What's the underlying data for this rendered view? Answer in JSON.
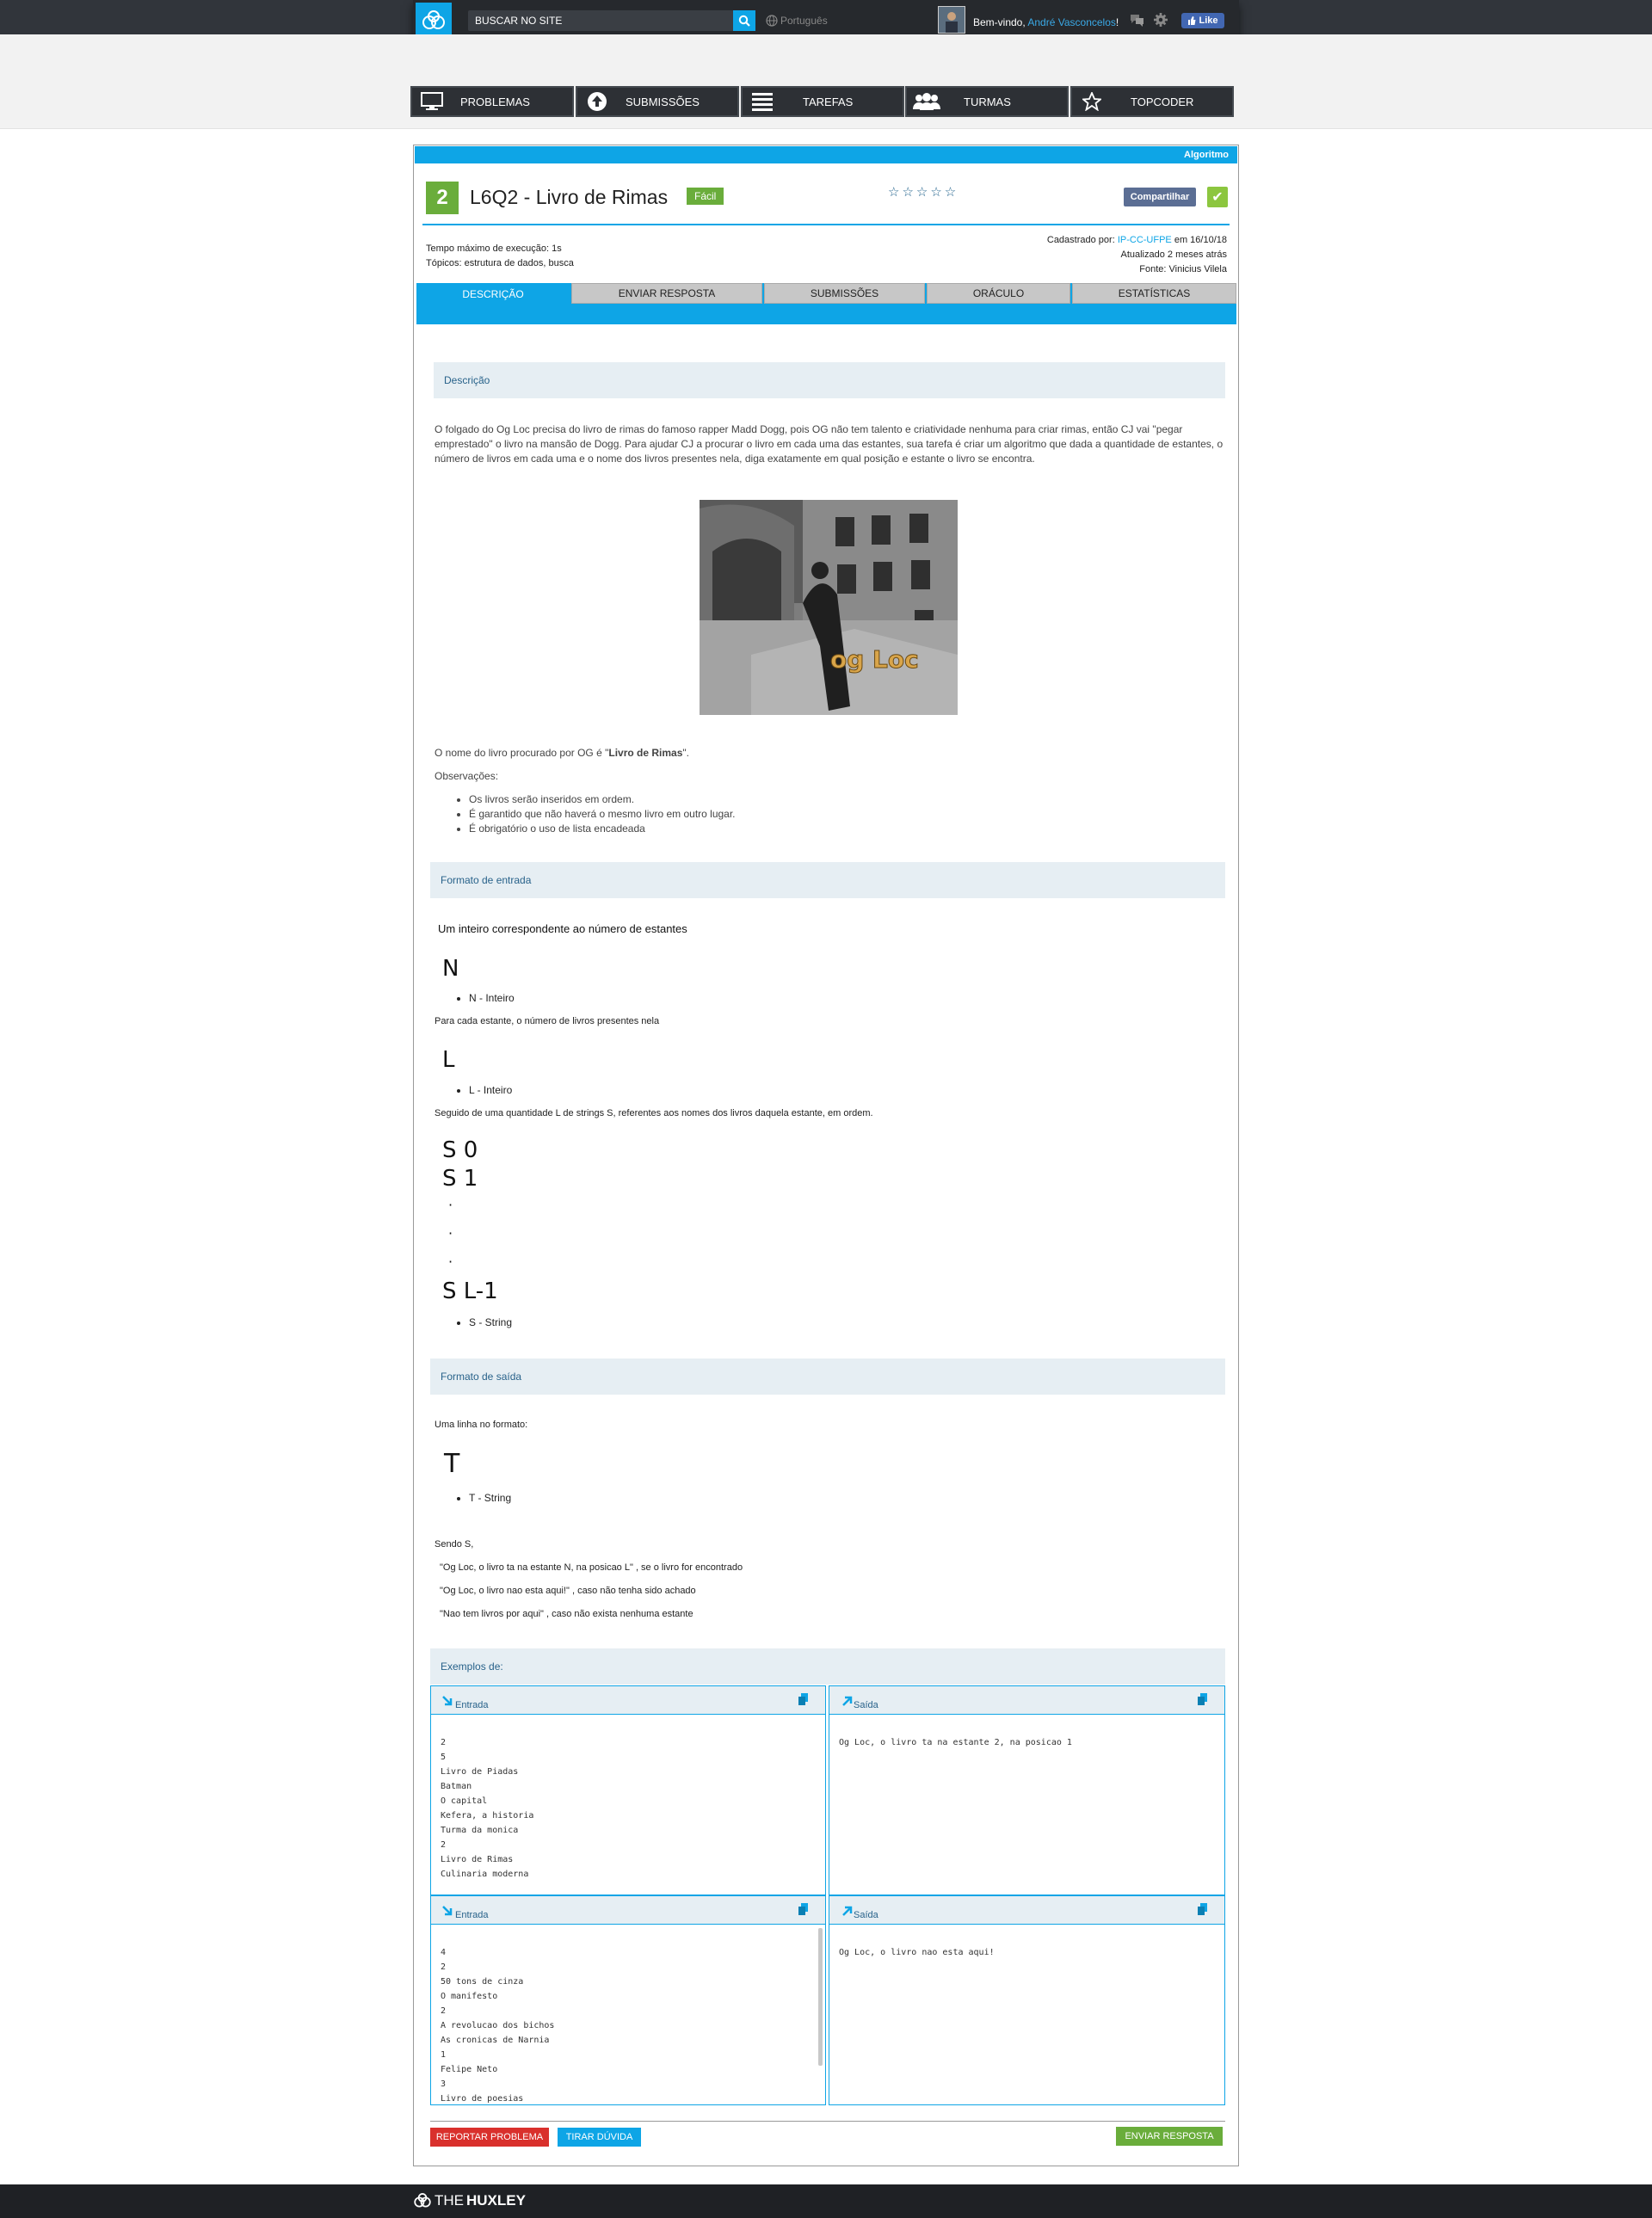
{
  "header": {
    "search_placeholder": "BUSCAR NO SITE",
    "language": "Português",
    "welcome_prefix": "Bem-vindo,",
    "user_name": "André Vasconcelos",
    "welcome_suffix": "!",
    "like_label": "Like"
  },
  "nav": [
    {
      "label": "PROBLEMAS",
      "icon": "monitor-icon"
    },
    {
      "label": "SUBMISSÕES",
      "icon": "upload-icon"
    },
    {
      "label": "TAREFAS",
      "icon": "list-icon"
    },
    {
      "label": "TURMAS",
      "icon": "group-icon"
    },
    {
      "label": "TOPCODER",
      "icon": "star-icon"
    }
  ],
  "problem": {
    "category": "Algoritmo",
    "number": "2",
    "title": "L6Q2 - Livro de Rimas",
    "difficulty": "Fácil",
    "rating_stars": "☆☆☆☆☆",
    "share_label": "Compartilhar",
    "time_limit": "Tempo máximo de execução: 1s",
    "topics": "Tópicos: estrutura de dados, busca",
    "registered_prefix": "Cadastrado por:",
    "registered_by": "IP-CC-UFPE",
    "registered_date": "em 16/10/18",
    "updated": "Atualizado 2 meses atrás",
    "source": "Fonte: Vinicius Vilela"
  },
  "tabs": [
    "DESCRIÇÃO",
    "ENVIAR RESPOSTA",
    "SUBMISSÕES",
    "ORÁCULO",
    "ESTATÍSTICAS"
  ],
  "description": {
    "heading": "Descrição",
    "para1": "O folgado do  Og Loc precisa do livro de rimas do famoso rapper Madd Dogg, pois OG não tem talento e criatividade nenhuma para criar rimas, então CJ vai \"pegar emprestado\" o livro na mansão de Dogg. Para ajudar CJ a procurar o livro em cada uma das estantes, sua tarefa é criar um algoritmo que dada a quantidade de estantes, o número de livros em cada uma e o nome dos livros presentes nela, diga exatamente em qual posição e estante o livro se encontra.",
    "image_caption": "og Loc",
    "book_prefix": "O nome do livro procurado por OG é \"",
    "book_name": "Livro de Rimas",
    "book_suffix": "\".",
    "obs_label": "Observações:",
    "obs": [
      "Os livros serão inseridos em ordem.",
      "É garantido que não haverá o mesmo livro em outro lugar.",
      "É obrigatório o uso de lista encadeada"
    ]
  },
  "input_format": {
    "heading": "Formato de entrada",
    "intro": "Um inteiro correspondente ao número de estantes",
    "var_n": "N",
    "var_n_desc": "N - Inteiro",
    "line2": "Para cada estante, o número de livros presentes nela",
    "var_l": "L",
    "var_l_desc": "L - Inteiro",
    "line3": "Seguido de uma quantidade L de strings S, referentes aos nomes dos livros daquela estante, em ordem.",
    "s0": "S 0",
    "s1": "S 1",
    "dot": "·",
    "sl": "S L-1",
    "var_s_desc": "S - String"
  },
  "output_format": {
    "heading": "Formato de saída",
    "intro": "Uma linha no formato:",
    "var_t": "T",
    "var_t_desc": "T - String",
    "sendo": "Sendo S,",
    "opt1": "\"Og Loc, o livro ta na estante N, na posicao  L\" , se o livro for encontrado",
    "opt2": "\"Og Loc, o livro nao esta aqui!\" , caso não tenha sido achado",
    "opt3": "\"Nao tem livros por aqui\" , caso não exista nenhuma estante"
  },
  "examples": {
    "heading": "Exemplos de:",
    "input_label": "Entrada",
    "output_label": "Saída",
    "items": [
      {
        "input": "2\n5\nLivro de Piadas\nBatman\nO capital\nKefera, a historia\nTurma da monica\n2\nLivro de Rimas\nCulinaria moderna",
        "output": "Og Loc, o livro ta na estante 2, na posicao 1"
      },
      {
        "input": "4\n2\n50 tons de cinza\nO manifesto\n2\nA revolucao dos bichos\nAs cronicas de Narnia\n1\nFelipe Neto\n3\nLivro de poesias",
        "output": "Og Loc, o livro nao esta aqui!"
      }
    ]
  },
  "actions": {
    "report": "REPORTAR PROBLEMA",
    "ask": "TIRAR DÚVIDA",
    "submit": "ENVIAR RESPOSTA"
  },
  "footer": {
    "brand_prefix": "THE",
    "brand_main": "HUXLEY"
  },
  "colors": {
    "accent": "#0ea5e6",
    "success": "#6aad3b",
    "danger": "#d9302c",
    "header_bg": "#26292d"
  }
}
